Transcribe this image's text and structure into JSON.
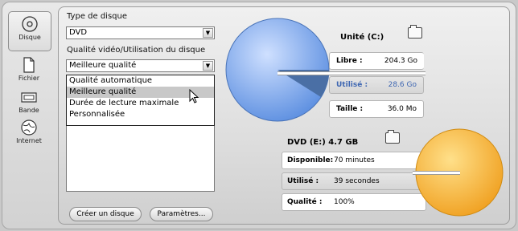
{
  "sidebar": {
    "items": [
      {
        "label": "Disque",
        "icon": "disc-icon",
        "active": true
      },
      {
        "label": "Fichier",
        "icon": "file-icon",
        "active": false
      },
      {
        "label": "Bande",
        "icon": "tape-icon",
        "active": false
      },
      {
        "label": "Internet",
        "icon": "globe-icon",
        "active": false
      }
    ]
  },
  "disc_type": {
    "label": "Type de disque",
    "value": "DVD"
  },
  "quality": {
    "label": "Qualité vidéo/Utilisation du disque",
    "value": "Meilleure qualité",
    "options": [
      "Qualité automatique",
      "Meilleure qualité",
      "Durée de lecture maximale",
      "Personnalisée"
    ],
    "highlighted_index": 1
  },
  "buttons": {
    "create": "Créer un disque",
    "params": "Paramètres..."
  },
  "drive": {
    "title": "Unité (C:)",
    "rows": [
      {
        "key": "Libre :",
        "value": "204.3 Go"
      },
      {
        "key": "Utilisé :",
        "value": "28.6 Go"
      },
      {
        "key": "Taille :",
        "value": "36.0 Mo"
      }
    ],
    "pie_color": "#7aa6e8",
    "used_color": "#4a6fa5"
  },
  "dvd": {
    "title": "DVD  (E:)  4.7 GB",
    "rows": [
      {
        "key": "Disponible:",
        "value": "70 minutes"
      },
      {
        "key": "Utilisé :",
        "value": "39 secondes"
      },
      {
        "key": "Qualité :",
        "value": "100%"
      }
    ],
    "pie_color": "#f5a623"
  }
}
